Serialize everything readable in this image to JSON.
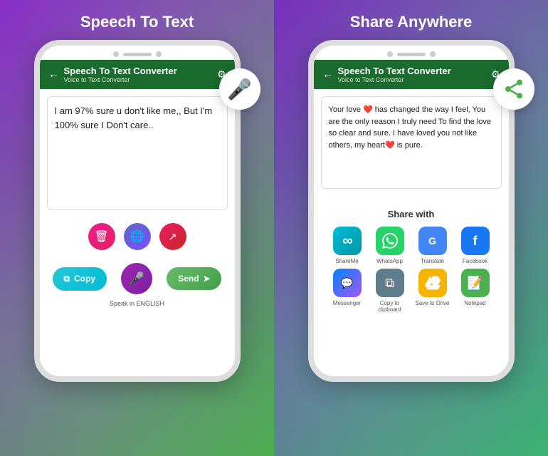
{
  "left": {
    "title": "Speech To Text",
    "phone": {
      "header": {
        "back_label": "←",
        "app_title": "Speech To Text Converter",
        "app_subtitle": "Voice to Text Converter",
        "gear": "⚙"
      },
      "text_content": "I am 97% sure u don't like me,, But I'm 100% sure I Don't care..",
      "buttons": {
        "delete": "🗑",
        "translate": "🌐",
        "share": "↗",
        "copy": "Copy",
        "send": "Send",
        "speak_label": "Speak in ENGLISH"
      }
    },
    "mic_icon": "🎤"
  },
  "right": {
    "title": "Share Anywhere",
    "phone": {
      "header": {
        "back_label": "←",
        "app_title": "Speech To Text Converter",
        "app_subtitle": "Voice to Text Converter",
        "gear": "⚙"
      },
      "text_content": "Your love ❤️ has changed the way I feel, You are the only reason I truly need To find the love so clear and sure. I have loved you not like others, my heart❤️ is pure.",
      "share_sheet": {
        "title": "Share with",
        "apps": [
          {
            "name": "ShareMe",
            "icon_class": "icon-shareme",
            "icon": "∞"
          },
          {
            "name": "WhatsApp",
            "icon_class": "icon-whatsapp",
            "icon": "💬"
          },
          {
            "name": "Translate",
            "icon_class": "icon-translate",
            "icon": "G"
          },
          {
            "name": "Facebook",
            "icon_class": "icon-facebook",
            "icon": "f"
          },
          {
            "name": "Messenger",
            "icon_class": "icon-messenger",
            "icon": "m"
          },
          {
            "name": "Copy to clipboard",
            "icon_class": "icon-clipboard",
            "icon": "⧉"
          },
          {
            "name": "Save to Drive",
            "icon_class": "icon-drive",
            "icon": "▲"
          },
          {
            "name": "Notepad",
            "icon_class": "icon-notepad",
            "icon": "📝"
          }
        ]
      }
    },
    "share_icon": "↗"
  }
}
